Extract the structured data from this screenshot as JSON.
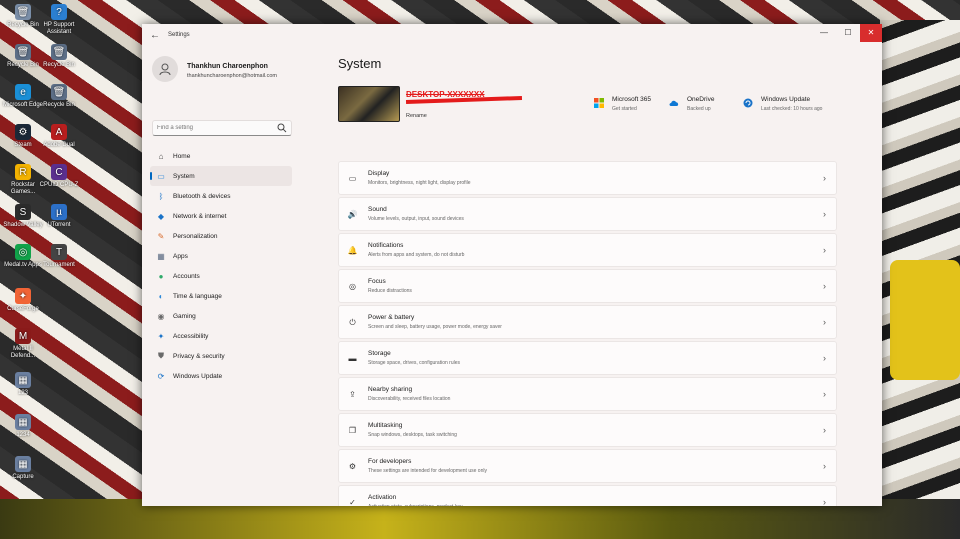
{
  "desktop": {
    "icons": [
      {
        "label": "Recycle Bin",
        "color": "#7a8ea8",
        "glyph": "🗑"
      },
      {
        "label": "HP Support Assistant",
        "color": "#2b7fd1",
        "glyph": "?"
      },
      {
        "label": "Recycle Bin",
        "color": "#5c6e86",
        "glyph": "🗑"
      },
      {
        "label": "Recycle Bin",
        "color": "#5c6e86",
        "glyph": "🗑"
      },
      {
        "label": "Microsoft Edge",
        "color": "#1a8fd6",
        "glyph": "e"
      },
      {
        "label": "Recycle Bin",
        "color": "#5c6e86",
        "glyph": "🗑"
      },
      {
        "label": "Steam",
        "color": "#1b2838",
        "glyph": "⚙"
      },
      {
        "label": "Adobe Dual",
        "color": "#b81e1e",
        "glyph": "A"
      },
      {
        "label": "Rockstar Games...",
        "color": "#f3b200",
        "glyph": "R"
      },
      {
        "label": "CPUID CPU-Z",
        "color": "#5b2f8f",
        "glyph": "C"
      },
      {
        "label": "Shadow Valley",
        "color": "#2c2c2c",
        "glyph": "S"
      },
      {
        "label": "UTorrent",
        "color": "#2c70c8",
        "glyph": "µ"
      },
      {
        "label": "Medal.tv Apps",
        "color": "#11a34a",
        "glyph": "◎"
      },
      {
        "label": "Tournament",
        "color": "#444",
        "glyph": "T"
      },
      {
        "label": "CurseForge",
        "color": "#f16436",
        "glyph": "✦"
      },
      {
        "label": "Metal II Defend...",
        "color": "#8a1a1a",
        "glyph": "M"
      },
      {
        "label": "123",
        "color": "#6a7fa0",
        "glyph": "▦"
      },
      {
        "label": "1234",
        "color": "#6a7fa0",
        "glyph": "▦"
      },
      {
        "label": "Capture",
        "color": "#6a7fa0",
        "glyph": "▦"
      }
    ]
  },
  "window": {
    "title": "Settings",
    "back_glyph": "←",
    "min_glyph": "—",
    "max_glyph": "☐",
    "close_glyph": "✕"
  },
  "profile": {
    "name": "Thankhun Charoenphon",
    "email": "thankhuncharoenphon@hotmail.com"
  },
  "search": {
    "placeholder": "Find a setting"
  },
  "nav": [
    {
      "label": "Home",
      "icon": "home-icon",
      "glyph": "⌂",
      "color": "#444",
      "active": false
    },
    {
      "label": "System",
      "icon": "monitor-icon",
      "glyph": "▭",
      "color": "#2b88d8",
      "active": true
    },
    {
      "label": "Bluetooth & devices",
      "icon": "bluetooth-icon",
      "glyph": "ᛒ",
      "color": "#1a73c8",
      "active": false
    },
    {
      "label": "Network & internet",
      "icon": "wifi-icon",
      "glyph": "◆",
      "color": "#1a73c8",
      "active": false
    },
    {
      "label": "Personalization",
      "icon": "brush-icon",
      "glyph": "✎",
      "color": "#d86b2d",
      "active": false
    },
    {
      "label": "Apps",
      "icon": "apps-icon",
      "glyph": "▦",
      "color": "#5a6a82",
      "active": false
    },
    {
      "label": "Accounts",
      "icon": "accounts-icon",
      "glyph": "●",
      "color": "#2faa6a",
      "active": false
    },
    {
      "label": "Time & language",
      "icon": "globe-icon",
      "glyph": "◐",
      "color": "#2b88d8",
      "active": false
    },
    {
      "label": "Gaming",
      "icon": "gamepad-icon",
      "glyph": "◉",
      "color": "#6a6a6a",
      "active": false
    },
    {
      "label": "Accessibility",
      "icon": "accessibility-icon",
      "glyph": "✦",
      "color": "#1a73c8",
      "active": false
    },
    {
      "label": "Privacy & security",
      "icon": "shield-icon",
      "glyph": "⛊",
      "color": "#6a6a6a",
      "active": false
    },
    {
      "label": "Windows Update",
      "icon": "update-icon",
      "glyph": "⟳",
      "color": "#1a73c8",
      "active": false
    }
  ],
  "main": {
    "title": "System",
    "device": {
      "name": "DESKTOP-XXXXXXX",
      "rename": "Rename"
    },
    "quick": [
      {
        "title": "Microsoft 365",
        "sub": "Get started",
        "icon": "microsoft-365-icon"
      },
      {
        "title": "OneDrive",
        "sub": "Backed up",
        "icon": "onedrive-icon"
      },
      {
        "title": "Windows Update",
        "sub": "Last checked: 10 hours ago",
        "icon": "windows-update-icon"
      }
    ],
    "cards": [
      {
        "title": "Display",
        "sub": "Monitors, brightness, night light, display profile",
        "icon": "display-icon",
        "glyph": "▭"
      },
      {
        "title": "Sound",
        "sub": "Volume levels, output, input, sound devices",
        "icon": "speaker-icon",
        "glyph": "🔊"
      },
      {
        "title": "Notifications",
        "sub": "Alerts from apps and system, do not disturb",
        "icon": "bell-icon",
        "glyph": "🔔"
      },
      {
        "title": "Focus",
        "sub": "Reduce distractions",
        "icon": "focus-icon",
        "glyph": "◎"
      },
      {
        "title": "Power & battery",
        "sub": "Screen and sleep, battery usage, power mode, energy saver",
        "icon": "power-icon",
        "glyph": "⏻"
      },
      {
        "title": "Storage",
        "sub": "Storage space, drives, configuration rules",
        "icon": "storage-icon",
        "glyph": "▬"
      },
      {
        "title": "Nearby sharing",
        "sub": "Discoverability, received files location",
        "icon": "share-icon",
        "glyph": "⇪"
      },
      {
        "title": "Multitasking",
        "sub": "Snap windows, desktops, task switching",
        "icon": "multitask-icon",
        "glyph": "❐"
      },
      {
        "title": "For developers",
        "sub": "These settings are intended for development use only",
        "icon": "developer-icon",
        "glyph": "⚙"
      },
      {
        "title": "Activation",
        "sub": "Activation state, subscriptions, product key",
        "icon": "activation-icon",
        "glyph": "✓"
      },
      {
        "title": "",
        "sub": "",
        "icon": "more-icon",
        "glyph": ""
      }
    ],
    "chevron": "›"
  }
}
